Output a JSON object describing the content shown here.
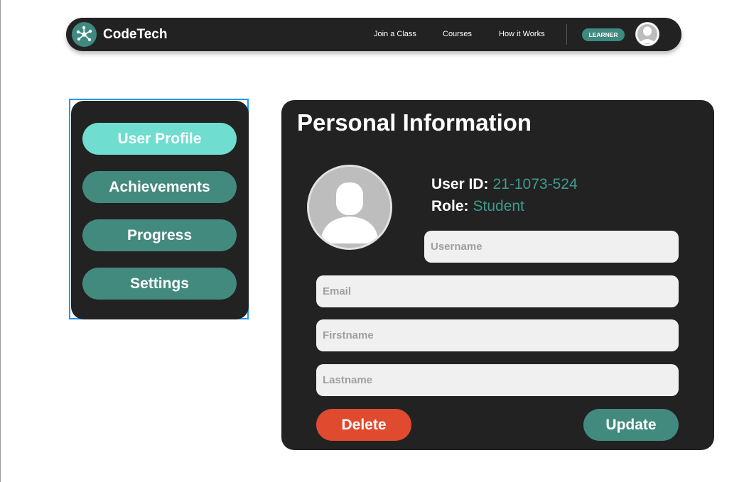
{
  "colors": {
    "accent": "#438a7e",
    "accent_light": "#6fddd0",
    "dark": "#222222",
    "danger": "#e04a2e",
    "value_text": "#3f9a8c"
  },
  "navbar": {
    "brand": "CodeTech",
    "logo_icon": "network-nodes-icon",
    "links": [
      "Join a Class",
      "Courses",
      "How it Works"
    ],
    "role_badge": "LEARNER",
    "avatar_icon": "user-avatar-icon"
  },
  "sidebar": {
    "items": [
      {
        "label": "User Profile",
        "active": true
      },
      {
        "label": "Achievements",
        "active": false
      },
      {
        "label": "Progress",
        "active": false
      },
      {
        "label": "Settings",
        "active": false
      }
    ]
  },
  "profile": {
    "title": "Personal Information",
    "avatar_icon": "user-avatar-icon",
    "user_id_label": "User ID:",
    "user_id": "21-1073-524",
    "role_label": "Role:",
    "role": "Student",
    "fields": {
      "username_placeholder": "Username",
      "email_placeholder": "Email",
      "firstname_placeholder": "Firstname",
      "lastname_placeholder": "Lastname"
    },
    "delete_label": "Delete",
    "update_label": "Update"
  }
}
